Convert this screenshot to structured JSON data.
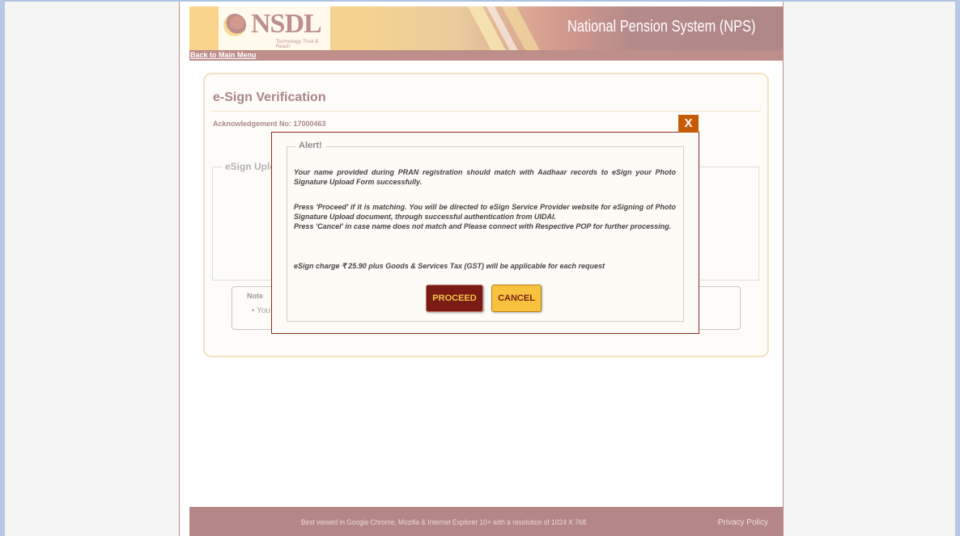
{
  "header": {
    "logo_text": "NSDL",
    "logo_tagline": "Technology, Trust & Reach",
    "site_title": "National Pension System (NPS)",
    "back_link": "Back to Main Menu"
  },
  "page": {
    "title": "e-Sign Verification",
    "acknowledgement": "Acknowledgement No: 17000463",
    "upload_section_legend": "eSign Upload",
    "note_title": "Note",
    "note_item": "• You"
  },
  "modal": {
    "close_label": "X",
    "legend": "Alert!",
    "message_1": "Your name provided during PRAN registration should match with Aadhaar records to eSign your Photo Signature Upload Form successfully.",
    "message_2": "Press 'Proceed' if it is matching. You will be directed to eSign Service Provider website for eSigning of Photo Signature Upload document, through successful authentication from UIDAI.",
    "message_3": "Press 'Cancel' in case name does not match and Please connect with Respective POP for further processing.",
    "message_4": "eSign charge ₹ 25.90 plus Goods & Services Tax (GST) will be applicable for each request",
    "proceed_label": "PROCEED",
    "cancel_label": "CANCEL"
  },
  "footer": {
    "text": "Best viewed in Google Chrome, Mozilla & Internet Explorer 10+ with a resolution of 1024 X 768.",
    "privacy": "Privacy Policy"
  },
  "colors": {
    "brand_maroon": "#7a1c14",
    "accent_gold": "#f7c33f",
    "close_orange": "#c65b05"
  }
}
